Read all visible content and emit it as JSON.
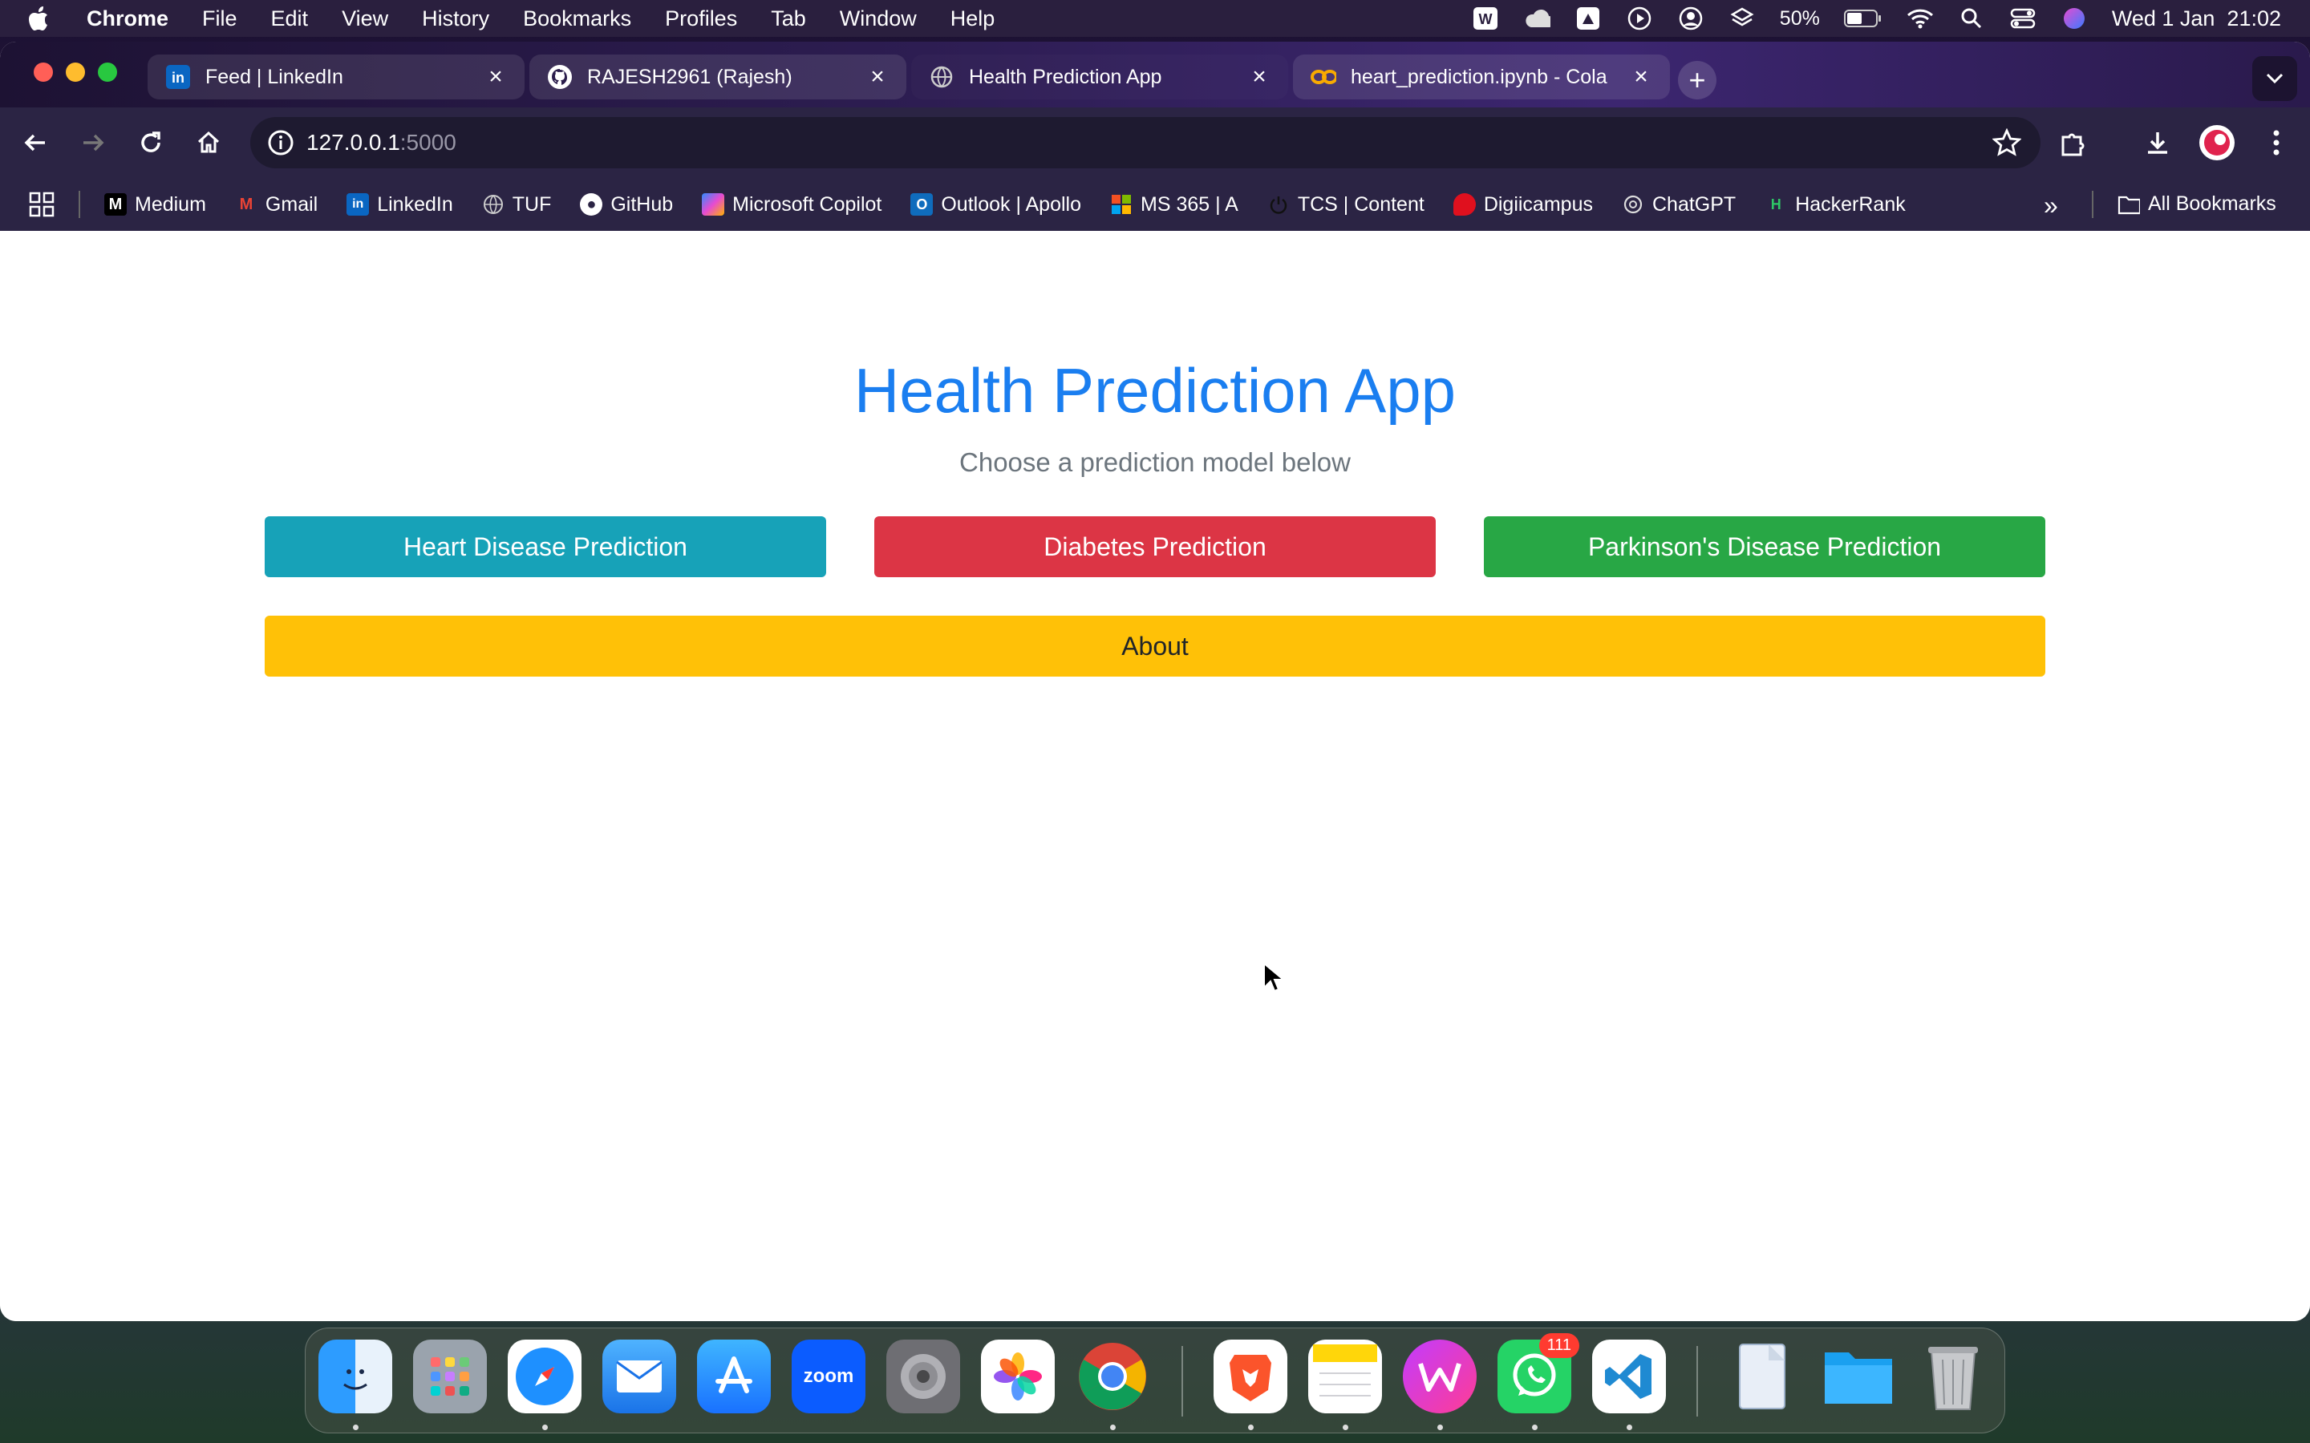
{
  "menubar": {
    "app_name": "Chrome",
    "items": [
      "File",
      "Edit",
      "View",
      "History",
      "Bookmarks",
      "Profiles",
      "Tab",
      "Window",
      "Help"
    ],
    "battery": "50%",
    "datetime": "Wed 1 Jan  21:02"
  },
  "tabs": [
    {
      "title": "Feed | LinkedIn",
      "favicon": "linkedin-icon"
    },
    {
      "title": "RAJESH2961 (Rajesh)",
      "favicon": "github-icon"
    },
    {
      "title": "Health Prediction App",
      "favicon": "globe-icon",
      "active": true
    },
    {
      "title": "heart_prediction.ipynb - Cola",
      "favicon": "colab-icon"
    }
  ],
  "address": {
    "host": "127.0.0.1",
    "port": ":5000"
  },
  "bookmarks": {
    "items": [
      {
        "label": "Medium",
        "icon": "medium-icon"
      },
      {
        "label": "Gmail",
        "icon": "gmail-icon"
      },
      {
        "label": "LinkedIn",
        "icon": "linkedin-icon"
      },
      {
        "label": "TUF",
        "icon": "globe-icon"
      },
      {
        "label": "GitHub",
        "icon": "github-icon"
      },
      {
        "label": "Microsoft Copilot",
        "icon": "copilot-icon"
      },
      {
        "label": "Outlook | Apollo",
        "icon": "outlook-icon"
      },
      {
        "label": "MS 365 | A",
        "icon": "microsoft-icon"
      },
      {
        "label": "TCS | Content",
        "icon": "power-icon"
      },
      {
        "label": "Digiicampus",
        "icon": "digiicampus-icon"
      },
      {
        "label": "ChatGPT",
        "icon": "chatgpt-icon"
      },
      {
        "label": "HackerRank",
        "icon": "hackerrank-icon"
      }
    ],
    "all_bookmarks": "All Bookmarks"
  },
  "page": {
    "title": "Health Prediction App",
    "subtitle": "Choose a prediction model below",
    "buttons": {
      "heart": "Heart Disease Prediction",
      "diabetes": "Diabetes Prediction",
      "parkinsons": "Parkinson's Disease Prediction",
      "about": "About"
    }
  },
  "colors": {
    "title_blue": "#1a7ef0",
    "heart_btn": "#17a2b8",
    "diabetes_btn": "#dc3545",
    "parkinsons_btn": "#28a745",
    "about_btn": "#ffc107"
  },
  "dock": {
    "apps": [
      "Finder",
      "Launchpad",
      "Safari",
      "Mail",
      "App Store",
      "Zoom",
      "System Settings",
      "Photos",
      "Chrome",
      "Brave",
      "Notes",
      "WPS Office",
      "WhatsApp",
      "VS Code",
      "Preview",
      "Folder",
      "Trash"
    ],
    "zoom_label": "zoom",
    "whatsapp_badge": "111"
  }
}
